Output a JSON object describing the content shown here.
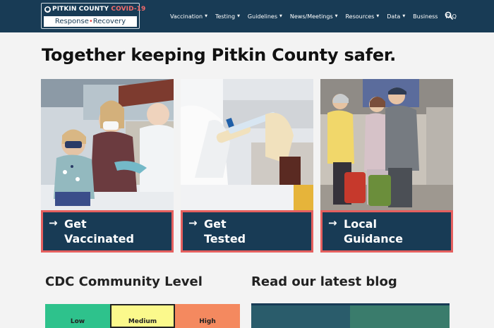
{
  "header": {
    "logo": {
      "name": "PITKIN COUNTY",
      "highlight": "COVID-19",
      "tagline_left": "Response",
      "tagline_sep": "•",
      "tagline_right": "Recovery"
    },
    "nav": [
      {
        "label": "Vaccination",
        "has_menu": true
      },
      {
        "label": "Testing",
        "has_menu": true
      },
      {
        "label": "Guidelines",
        "has_menu": true
      },
      {
        "label": "News/Meetings",
        "has_menu": true
      },
      {
        "label": "Resources",
        "has_menu": true
      },
      {
        "label": "Data",
        "has_menu": true
      },
      {
        "label": "Business",
        "has_menu": false
      },
      {
        "label": "FAQ",
        "has_menu": false
      }
    ],
    "caret": "▼",
    "search_icon": "search-icon"
  },
  "hero": {
    "title": "Together keeping Pitkin County safer."
  },
  "cards": [
    {
      "arrow": "→",
      "line1": "Get",
      "line2": "Vaccinated"
    },
    {
      "arrow": "→",
      "line1": "Get",
      "line2": "Tested"
    },
    {
      "arrow": "→",
      "line1": "Local",
      "line2": "Guidance"
    }
  ],
  "cdc": {
    "title": "CDC Community Level",
    "levels": [
      {
        "label": "Low",
        "color": "#2ec28c"
      },
      {
        "label": "Medium",
        "color": "#fbf98c"
      },
      {
        "label": "High",
        "color": "#f4895f"
      }
    ]
  },
  "blog": {
    "title": "Read our latest blog"
  },
  "colors": {
    "navy": "#183b55",
    "accent_red": "#e5605f"
  }
}
